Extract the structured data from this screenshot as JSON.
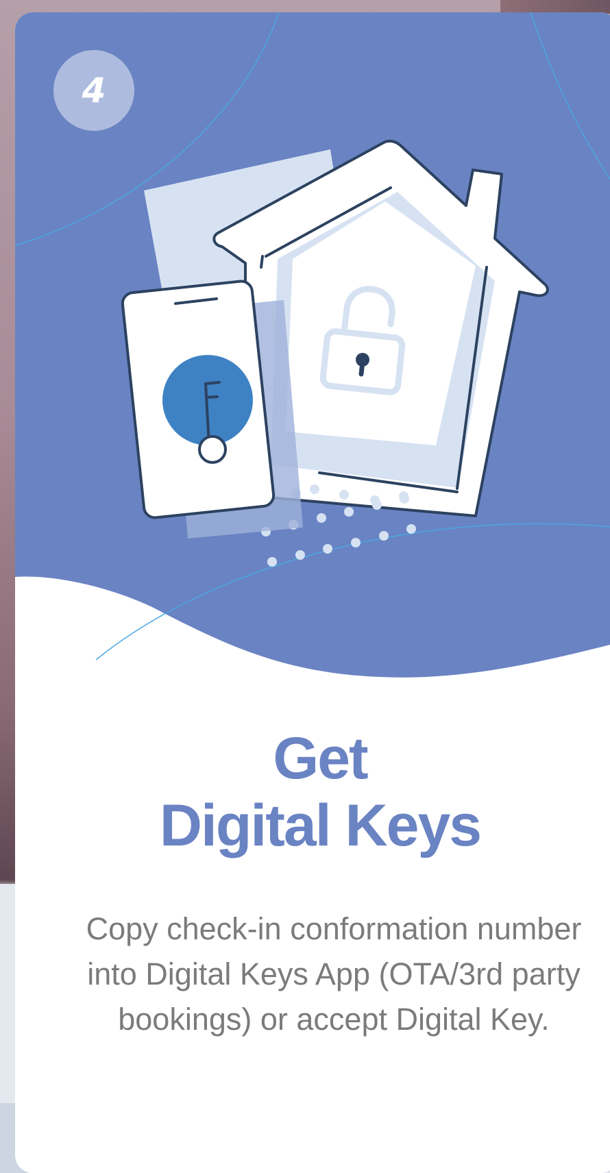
{
  "card": {
    "step_number": "4",
    "title_line1": "Get",
    "title_line2": "Digital Keys",
    "description": "Copy check-in conformation number into Digital Keys App (OTA/3rd party bookings) or accept Digital Key."
  },
  "illustration": {
    "icons": [
      "house-icon",
      "smartphone-icon",
      "key-icon",
      "unlocked-padlock-icon"
    ]
  },
  "colors": {
    "hero_background": "#6a83c3",
    "title": "#6a83c3",
    "description": "#7b7b7b",
    "key_circle": "#3e82c4",
    "outline": "#2c4260",
    "light_blue": "#d6e2f2"
  }
}
